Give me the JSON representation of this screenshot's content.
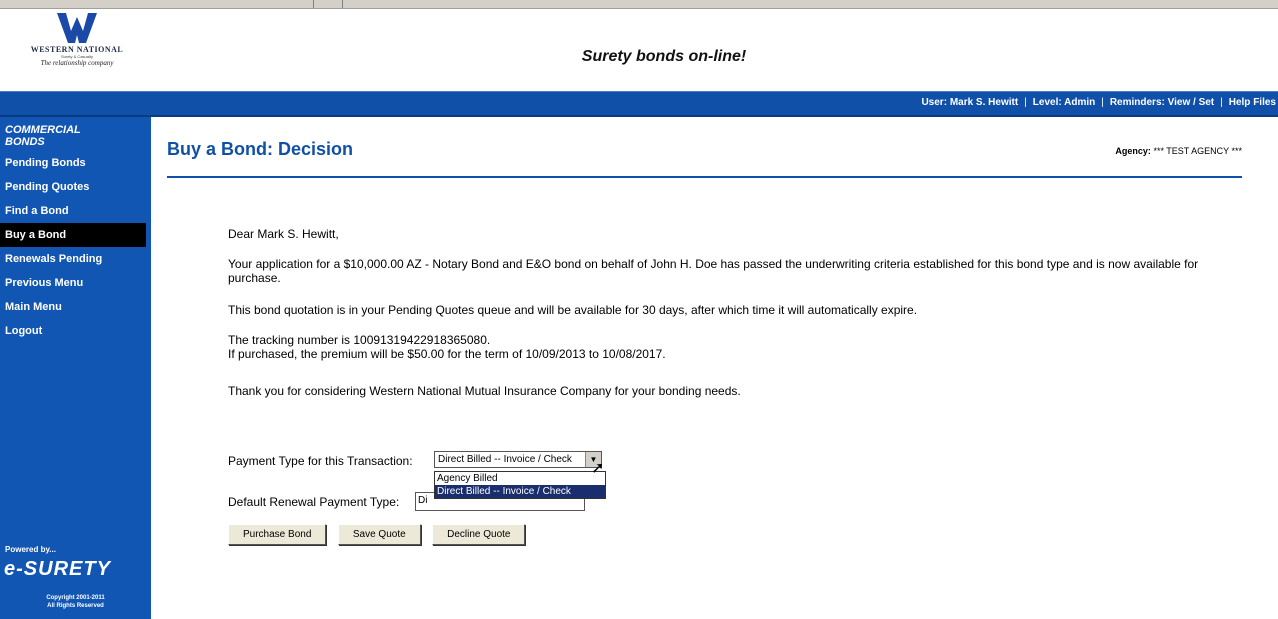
{
  "header": {
    "logo_line1": "WESTERN NATIONAL",
    "logo_line2": "Surety & Casualty",
    "logo_line3": "The relationship company",
    "tagline": "Surety bonds on-line!"
  },
  "userbar": {
    "user_label": "User:",
    "user_name": "Mark S. Hewitt",
    "level_label": "Level:",
    "level_value": "Admin",
    "reminders_label": "Reminders:",
    "view_set": "View / Set",
    "help_files": "Help Files"
  },
  "sidebar": {
    "title_line1": "COMMERCIAL",
    "title_line2": "BONDS",
    "items": [
      {
        "label": "Pending Bonds"
      },
      {
        "label": "Pending Quotes"
      },
      {
        "label": "Find a Bond"
      },
      {
        "label": "Buy a Bond",
        "active": true
      },
      {
        "label": "Renewals Pending"
      },
      {
        "label": "Previous Menu"
      },
      {
        "label": "Main Menu"
      },
      {
        "label": "Logout"
      }
    ],
    "powered_by": "Powered by...",
    "brand": "e-SURETY",
    "copyright_line1": "Copyright 2001-2011",
    "copyright_line2": "All Rights Reserved"
  },
  "main": {
    "title": "Buy a Bond: Decision",
    "agency_label": "Agency:",
    "agency_value": "*** TEST AGENCY ***",
    "greeting": "Dear Mark S. Hewitt,",
    "paragraph1": "Your application for a $10,000.00 AZ - Notary Bond and E&O bond on behalf of John H. Doe has passed the underwriting criteria established for this bond type and is now available for purchase.",
    "paragraph2": "This bond quotation is in your Pending Quotes queue and will be available for 30 days, after which time it will automatically expire.",
    "tracking": "The tracking number is 10091319422918365080.",
    "premium": "If purchased, the premium will be $50.00 for the term of 10/09/2013 to 10/08/2017.",
    "thanks": "Thank you for considering Western National Mutual Insurance Company for your bonding needs.",
    "payment_label": "Payment Type for this Transaction:",
    "payment_value": "Direct Billed -- Invoice / Check",
    "payment_options": [
      "Agency Billed",
      "Direct Billed -- Invoice / Check"
    ],
    "renewal_label": "Default Renewal Payment Type:",
    "renewal_value": "Di",
    "buttons": {
      "purchase": "Purchase Bond",
      "save": "Save Quote",
      "decline": "Decline Quote"
    }
  },
  "colors": {
    "brand_blue": "#1050a8",
    "sidebar_blue": "#1256b4",
    "active_item": "#000000",
    "dropdown_selected": "#1a2e6e"
  }
}
